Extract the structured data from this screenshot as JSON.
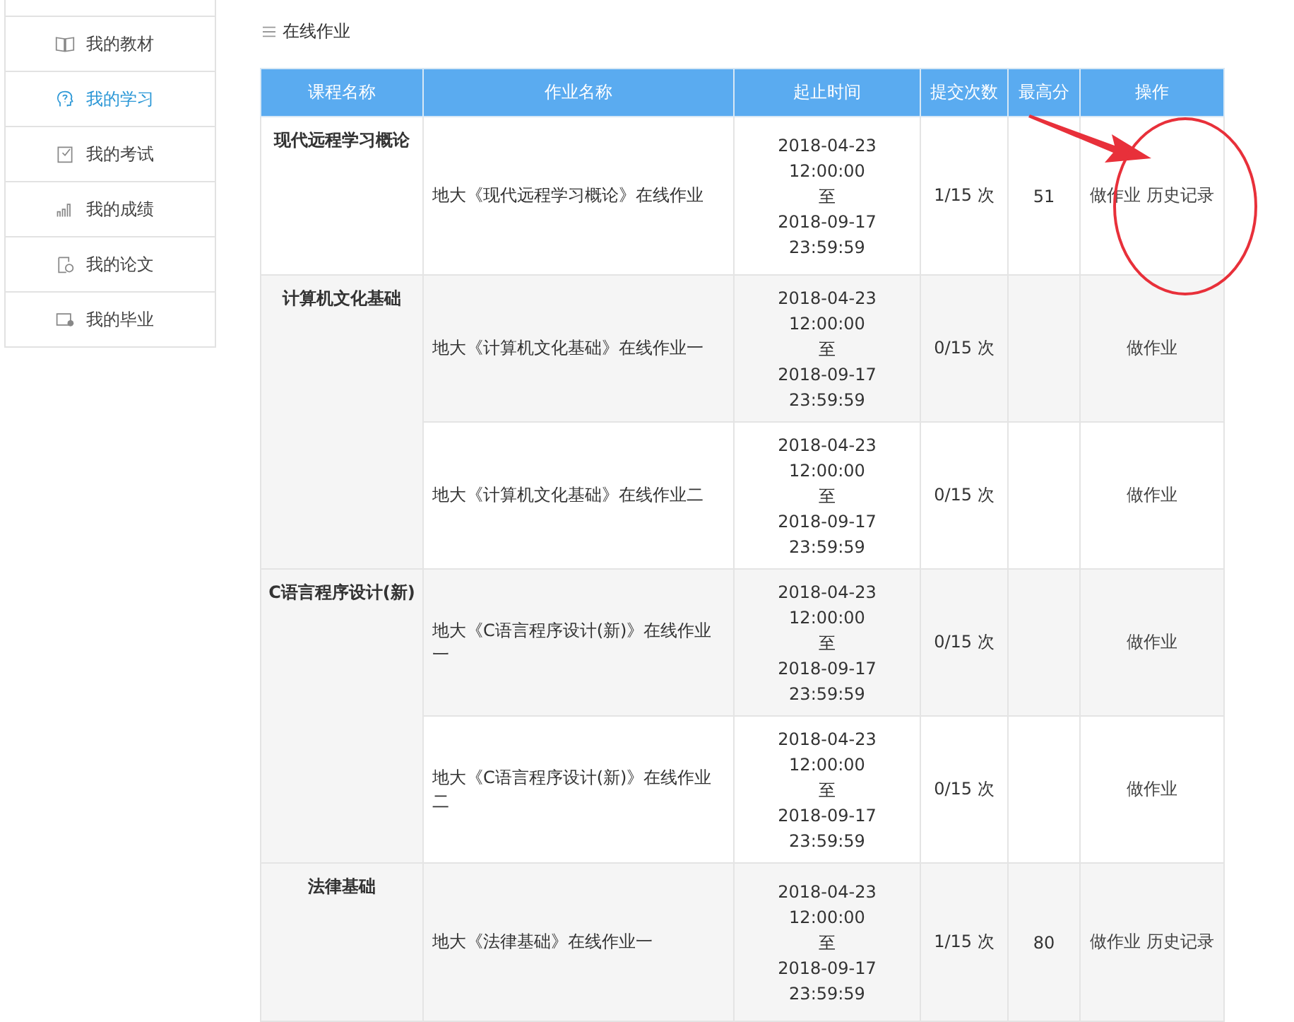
{
  "sidebar": {
    "items": [
      {
        "label": "我的教材",
        "selected": false
      },
      {
        "label": "我的学习",
        "selected": true
      },
      {
        "label": "我的考试",
        "selected": false
      },
      {
        "label": "我的成绩",
        "selected": false
      },
      {
        "label": "我的论文",
        "selected": false
      },
      {
        "label": "我的毕业",
        "selected": false
      }
    ]
  },
  "section_title": "在线作业",
  "table": {
    "columns": [
      "课程名称",
      "作业名称",
      "起止时间",
      "提交次数",
      "最高分",
      "操作"
    ],
    "courses": [
      {
        "name": "现代远程学习概论",
        "assignments": [
          {
            "name": "地大《现代远程学习概论》在线作业",
            "period": [
              "2018-04-23",
              "12:00:00",
              "至",
              "2018-09-17",
              "23:59:59"
            ],
            "submissions": "1/15 次",
            "top_score": "51",
            "actions": [
              "做作业",
              "历史记录"
            ]
          }
        ]
      },
      {
        "name": "计算机文化基础",
        "assignments": [
          {
            "name": "地大《计算机文化基础》在线作业一",
            "period": [
              "2018-04-23",
              "12:00:00",
              "至",
              "2018-09-17",
              "23:59:59"
            ],
            "submissions": "0/15 次",
            "actions": [
              "做作业"
            ]
          },
          {
            "name": "地大《计算机文化基础》在线作业二",
            "period": [
              "2018-04-23",
              "12:00:00",
              "至",
              "2018-09-17",
              "23:59:59"
            ],
            "submissions": "0/15 次",
            "actions": [
              "做作业"
            ]
          }
        ]
      },
      {
        "name": "C语言程序设计(新)",
        "assignments": [
          {
            "name": "地大《C语言程序设计(新)》在线作业一",
            "period": [
              "2018-04-23",
              "12:00:00",
              "至",
              "2018-09-17",
              "23:59:59"
            ],
            "submissions": "0/15 次",
            "actions": [
              "做作业"
            ]
          },
          {
            "name": "地大《C语言程序设计(新)》在线作业二",
            "period": [
              "2018-04-23",
              "12:00:00",
              "至",
              "2018-09-17",
              "23:59:59"
            ],
            "submissions": "0/15 次",
            "actions": [
              "做作业"
            ]
          }
        ]
      },
      {
        "name": "法律基础",
        "assignments": [
          {
            "name": "地大《法律基础》在线作业一",
            "period": [
              "2018-04-23",
              "12:00:00",
              "至",
              "2018-09-17",
              "23:59:59"
            ],
            "submissions": "1/15 次",
            "top_score": "80",
            "actions": [
              "做作业",
              "历史记录"
            ]
          }
        ]
      }
    ]
  }
}
